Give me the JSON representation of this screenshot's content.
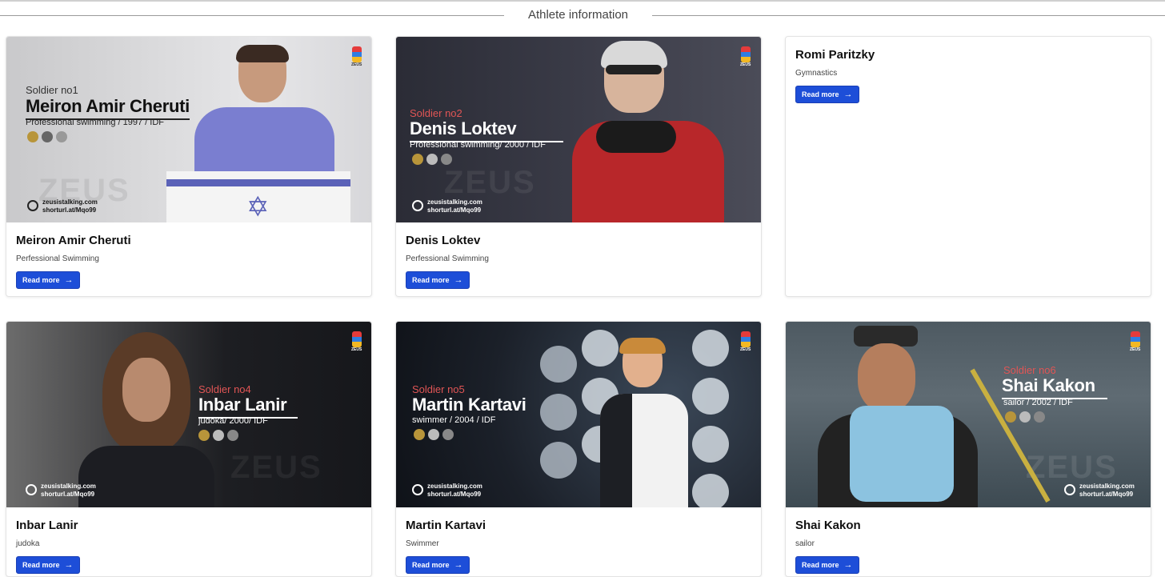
{
  "section": {
    "title": "Athlete information"
  },
  "cards": [
    {
      "name": "Meiron Amir Cheruti",
      "sport": "Perfessional Swimming",
      "button": "Read more",
      "poster": {
        "soldier": "Soldier no1",
        "name": "Meiron Amir Cheruti",
        "line": "Professional swimming / 1997 / IDF",
        "site1": "zeusistalking.com",
        "site2": "shorturl.at/Mqo99",
        "brand": "ZEUS"
      }
    },
    {
      "name": "Denis Loktev",
      "sport": "Perfessional Swimming",
      "button": "Read more",
      "poster": {
        "soldier": "Soldier no2",
        "name": "Denis Loktev",
        "line": "Professional swimming/ 2000 / IDF",
        "site1": "zeusistalking.com",
        "site2": "shorturl.at/Mqo99",
        "brand": "ZEUS"
      }
    },
    {
      "name": "Romi Paritzky",
      "sport": "Gymnastics",
      "button": "Read more"
    },
    {
      "name": "Inbar Lanir",
      "sport": "judoka",
      "button": "Read more",
      "poster": {
        "soldier": "Soldier no4",
        "name": "Inbar Lanir",
        "line": "judoka/ 2000/ IDF",
        "site1": "zeusistalking.com",
        "site2": "shorturl.at/Mqo99",
        "brand": "ZEUS"
      }
    },
    {
      "name": "Martin Kartavi",
      "sport": "Swimmer",
      "button": "Read more",
      "poster": {
        "soldier": "Soldier no5",
        "name": "Martin Kartavi",
        "line": "swimmer / 2004 / IDF",
        "site1": "zeusistalking.com",
        "site2": "shorturl.at/Mqo99",
        "brand": "ZEUS"
      }
    },
    {
      "name": "Shai Kakon",
      "sport": "sailor",
      "button": "Read more",
      "poster": {
        "soldier": "Soldier no6",
        "name": "Shai Kakon",
        "line": "sailor / 2002 / IDF",
        "site1": "zeusistalking.com",
        "site2": "shorturl.at/Mqo99",
        "brand": "ZEUS"
      }
    }
  ],
  "colors": {
    "accent": "#1d4ed8",
    "soldier_red": "#e05555"
  },
  "icons": {
    "button_arrow": "arrow-right-icon",
    "site": "globe-icon",
    "logo": "zeus-logo-icon"
  }
}
